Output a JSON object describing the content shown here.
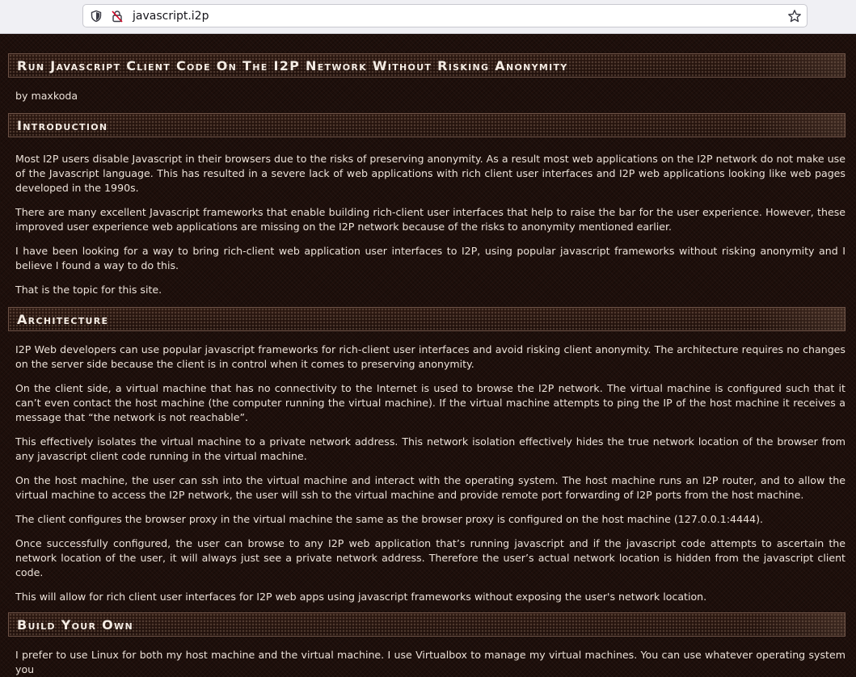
{
  "browser": {
    "url": "javascript.i2p"
  },
  "page": {
    "title": "Run Javascript Client Code On The I2P Network Without Risking Anonymity",
    "byline": "by maxkoda",
    "sections": [
      {
        "heading": "Introduction",
        "paragraphs": [
          "Most I2P users disable Javascript in their browsers due to the risks of preserving anonymity. As a result most web applications on the I2P network do not make use of the Javascript language. This has resulted in a severe lack of web applications with rich client user interfaces and I2P web applications looking like web pages developed in the 1990s.",
          "There are many excellent Javascript frameworks that enable building rich-client user interfaces that help to raise the bar for the user experience. However, these improved user experience web applications are missing on the I2P network because of the risks to anonymity mentioned earlier.",
          "I have been looking for a way to bring rich-client web application user interfaces to I2P, using popular javascript frameworks without risking anonymity and I believe I found a way to do this.",
          "That is the topic for this site."
        ]
      },
      {
        "heading": "Architecture",
        "paragraphs": [
          "I2P Web developers can use popular javascript frameworks for rich-client user interfaces and avoid risking client anonymity. The architecture requires no changes on the server side because the client is in control when it comes to preserving anonymity.",
          "On the client side, a virtual machine that has no connectivity to the Internet is used to browse the I2P network. The virtual machine is configured such that it can’t even contact the host machine (the computer running the virtual machine). If the virtual machine attempts to ping the IP of the host machine it receives a message that “the network is not reachable”.",
          "This effectively isolates the virtual machine to a private network address. This network isolation effectively hides the true network location of the browser from any javascript client code running in the virtual machine.",
          "On the host machine, the user can ssh into the virtual machine and interact with the operating system. The host machine runs an I2P router, and to allow the virtual machine to access the I2P network, the user will ssh to the virtual machine and provide remote port forwarding of I2P ports from the host machine.",
          "The client configures the browser proxy in the virtual machine the same as the browser proxy is configured on the host machine (127.0.0.1:4444).",
          "Once successfully configured, the user can browse to any I2P web application that’s running javascript and if the javascript code attempts to ascertain the network location of the user, it will always just see a private network address. Therefore the user’s actual network location is hidden from the javascript client code.",
          "This will allow for rich client user interfaces for I2P web apps using javascript frameworks without exposing the user's network location."
        ]
      },
      {
        "heading": "Build Your Own",
        "paragraphs": [
          "I prefer to use Linux for both my host machine and the virtual machine. I use Virtualbox to manage my virtual machines. You can use whatever operating system you"
        ]
      }
    ]
  }
}
